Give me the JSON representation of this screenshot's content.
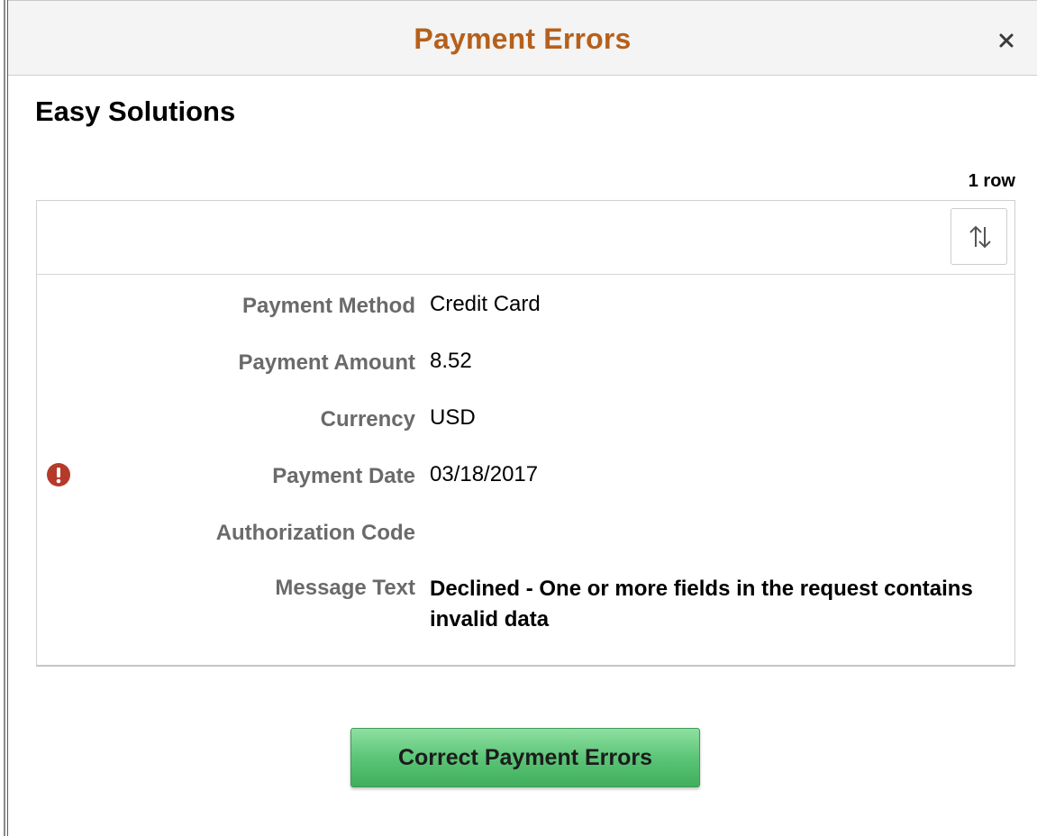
{
  "dialog": {
    "title": "Payment Errors",
    "close_label": "×",
    "title_color": "#b5601c"
  },
  "group": {
    "title": "Easy Solutions",
    "row_count": "1 row"
  },
  "toolbar": {
    "sort_icon": "sort-icon"
  },
  "fields": [
    {
      "label": "Payment Method",
      "value": "Credit Card"
    },
    {
      "label": "Payment Amount",
      "value": "8.52"
    },
    {
      "label": "Currency",
      "value": "USD"
    },
    {
      "label": "Payment Date",
      "value": "03/18/2017",
      "error": true
    },
    {
      "label": "Authorization Code",
      "value": ""
    },
    {
      "label": "Message Text",
      "value": "Declined - One or more fields in the request contains invalid data"
    }
  ],
  "icons": {
    "error_icon": "error-icon",
    "error_color": "#b53a2a"
  },
  "actions": {
    "primary_label": "Correct Payment Errors",
    "primary_color": "#5cc577"
  }
}
